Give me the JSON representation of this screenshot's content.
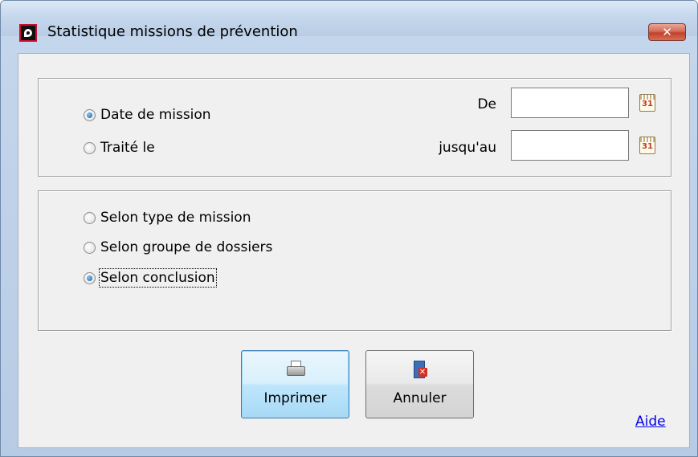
{
  "window": {
    "title": "Statistique missions de prévention",
    "close_label": "✕"
  },
  "period": {
    "options": [
      {
        "label": "Date de mission",
        "checked": true
      },
      {
        "label": "Traité le",
        "checked": false
      }
    ],
    "from_label": "De",
    "from_value": "",
    "to_label": "jusqu'au",
    "to_value": "",
    "calendar_day": "31"
  },
  "grouping": {
    "options": [
      {
        "label": "Selon type de mission",
        "checked": false
      },
      {
        "label": "Selon groupe de dossiers",
        "checked": false
      },
      {
        "label": "Selon conclusion",
        "checked": true
      }
    ]
  },
  "buttons": {
    "print_label": "Imprimer",
    "cancel_label": "Annuler"
  },
  "help_label": "Aide"
}
